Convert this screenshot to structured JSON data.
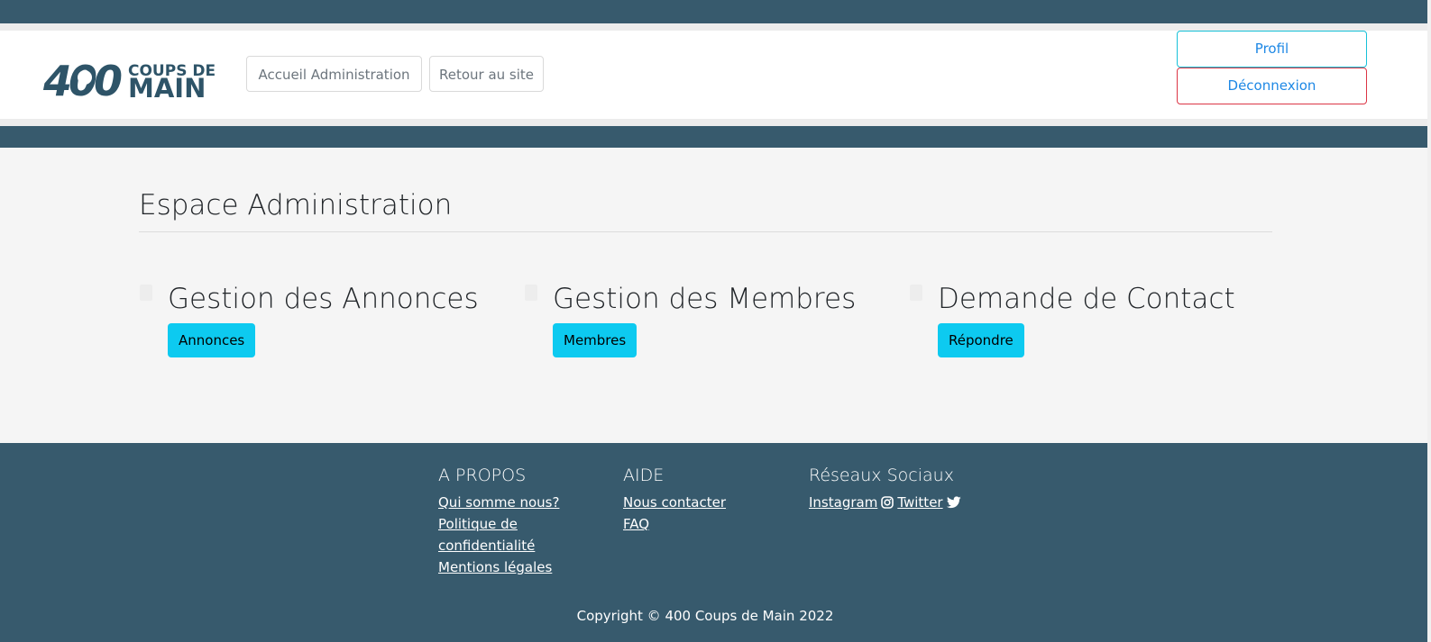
{
  "header": {
    "logo": {
      "number": "400",
      "line1": "COUPS DE",
      "line2": "MAIN"
    },
    "nav": [
      {
        "label": "Accueil Administration"
      },
      {
        "label": "Retour au site"
      }
    ],
    "profil_label": "Profil",
    "logout_label": "Déconnexion"
  },
  "main": {
    "title": "Espace Administration",
    "cards": [
      {
        "heading": "Gestion des Annonces",
        "button": "Annonces"
      },
      {
        "heading": "Gestion des Membres",
        "button": "Membres"
      },
      {
        "heading": "Demande de Contact",
        "button": "Répondre"
      }
    ]
  },
  "footer": {
    "about": {
      "title": "A PROPOS",
      "links": [
        "Qui somme nous?",
        "Politique de confidentialité",
        "Mentions légales"
      ]
    },
    "help": {
      "title": "AIDE",
      "links": [
        "Nous contacter",
        "FAQ"
      ]
    },
    "social": {
      "title": "Réseaux Sociaux",
      "links": [
        {
          "label": "Instagram",
          "icon": "instagram-icon"
        },
        {
          "label": "Twitter",
          "icon": "twitter-icon"
        }
      ]
    },
    "copyright": "Copyright © 400 Coups de Main 2022"
  },
  "colors": {
    "brand": "#375a6d",
    "accent": "#0dcaf0",
    "danger": "#dc3545"
  }
}
